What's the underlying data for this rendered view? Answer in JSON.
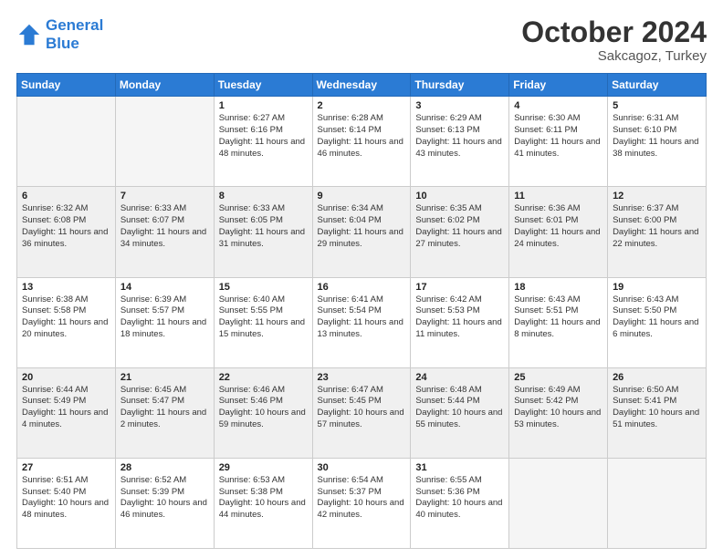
{
  "header": {
    "logo_line1": "General",
    "logo_line2": "Blue",
    "month": "October 2024",
    "location": "Sakcagoz, Turkey"
  },
  "days_of_week": [
    "Sunday",
    "Monday",
    "Tuesday",
    "Wednesday",
    "Thursday",
    "Friday",
    "Saturday"
  ],
  "weeks": [
    {
      "shade": "white",
      "days": [
        {
          "num": "",
          "empty": true
        },
        {
          "num": "",
          "empty": true
        },
        {
          "num": "1",
          "rise": "6:27 AM",
          "set": "6:16 PM",
          "daylight": "11 hours and 48 minutes."
        },
        {
          "num": "2",
          "rise": "6:28 AM",
          "set": "6:14 PM",
          "daylight": "11 hours and 46 minutes."
        },
        {
          "num": "3",
          "rise": "6:29 AM",
          "set": "6:13 PM",
          "daylight": "11 hours and 43 minutes."
        },
        {
          "num": "4",
          "rise": "6:30 AM",
          "set": "6:11 PM",
          "daylight": "11 hours and 41 minutes."
        },
        {
          "num": "5",
          "rise": "6:31 AM",
          "set": "6:10 PM",
          "daylight": "11 hours and 38 minutes."
        }
      ]
    },
    {
      "shade": "gray",
      "days": [
        {
          "num": "6",
          "rise": "6:32 AM",
          "set": "6:08 PM",
          "daylight": "11 hours and 36 minutes."
        },
        {
          "num": "7",
          "rise": "6:33 AM",
          "set": "6:07 PM",
          "daylight": "11 hours and 34 minutes."
        },
        {
          "num": "8",
          "rise": "6:33 AM",
          "set": "6:05 PM",
          "daylight": "11 hours and 31 minutes."
        },
        {
          "num": "9",
          "rise": "6:34 AM",
          "set": "6:04 PM",
          "daylight": "11 hours and 29 minutes."
        },
        {
          "num": "10",
          "rise": "6:35 AM",
          "set": "6:02 PM",
          "daylight": "11 hours and 27 minutes."
        },
        {
          "num": "11",
          "rise": "6:36 AM",
          "set": "6:01 PM",
          "daylight": "11 hours and 24 minutes."
        },
        {
          "num": "12",
          "rise": "6:37 AM",
          "set": "6:00 PM",
          "daylight": "11 hours and 22 minutes."
        }
      ]
    },
    {
      "shade": "white",
      "days": [
        {
          "num": "13",
          "rise": "6:38 AM",
          "set": "5:58 PM",
          "daylight": "11 hours and 20 minutes."
        },
        {
          "num": "14",
          "rise": "6:39 AM",
          "set": "5:57 PM",
          "daylight": "11 hours and 18 minutes."
        },
        {
          "num": "15",
          "rise": "6:40 AM",
          "set": "5:55 PM",
          "daylight": "11 hours and 15 minutes."
        },
        {
          "num": "16",
          "rise": "6:41 AM",
          "set": "5:54 PM",
          "daylight": "11 hours and 13 minutes."
        },
        {
          "num": "17",
          "rise": "6:42 AM",
          "set": "5:53 PM",
          "daylight": "11 hours and 11 minutes."
        },
        {
          "num": "18",
          "rise": "6:43 AM",
          "set": "5:51 PM",
          "daylight": "11 hours and 8 minutes."
        },
        {
          "num": "19",
          "rise": "6:43 AM",
          "set": "5:50 PM",
          "daylight": "11 hours and 6 minutes."
        }
      ]
    },
    {
      "shade": "gray",
      "days": [
        {
          "num": "20",
          "rise": "6:44 AM",
          "set": "5:49 PM",
          "daylight": "11 hours and 4 minutes."
        },
        {
          "num": "21",
          "rise": "6:45 AM",
          "set": "5:47 PM",
          "daylight": "11 hours and 2 minutes."
        },
        {
          "num": "22",
          "rise": "6:46 AM",
          "set": "5:46 PM",
          "daylight": "10 hours and 59 minutes."
        },
        {
          "num": "23",
          "rise": "6:47 AM",
          "set": "5:45 PM",
          "daylight": "10 hours and 57 minutes."
        },
        {
          "num": "24",
          "rise": "6:48 AM",
          "set": "5:44 PM",
          "daylight": "10 hours and 55 minutes."
        },
        {
          "num": "25",
          "rise": "6:49 AM",
          "set": "5:42 PM",
          "daylight": "10 hours and 53 minutes."
        },
        {
          "num": "26",
          "rise": "6:50 AM",
          "set": "5:41 PM",
          "daylight": "10 hours and 51 minutes."
        }
      ]
    },
    {
      "shade": "white",
      "days": [
        {
          "num": "27",
          "rise": "6:51 AM",
          "set": "5:40 PM",
          "daylight": "10 hours and 48 minutes."
        },
        {
          "num": "28",
          "rise": "6:52 AM",
          "set": "5:39 PM",
          "daylight": "10 hours and 46 minutes."
        },
        {
          "num": "29",
          "rise": "6:53 AM",
          "set": "5:38 PM",
          "daylight": "10 hours and 44 minutes."
        },
        {
          "num": "30",
          "rise": "6:54 AM",
          "set": "5:37 PM",
          "daylight": "10 hours and 42 minutes."
        },
        {
          "num": "31",
          "rise": "6:55 AM",
          "set": "5:36 PM",
          "daylight": "10 hours and 40 minutes."
        },
        {
          "num": "",
          "empty": true
        },
        {
          "num": "",
          "empty": true
        }
      ]
    }
  ],
  "labels": {
    "sunrise": "Sunrise:",
    "sunset": "Sunset:",
    "daylight": "Daylight:"
  }
}
